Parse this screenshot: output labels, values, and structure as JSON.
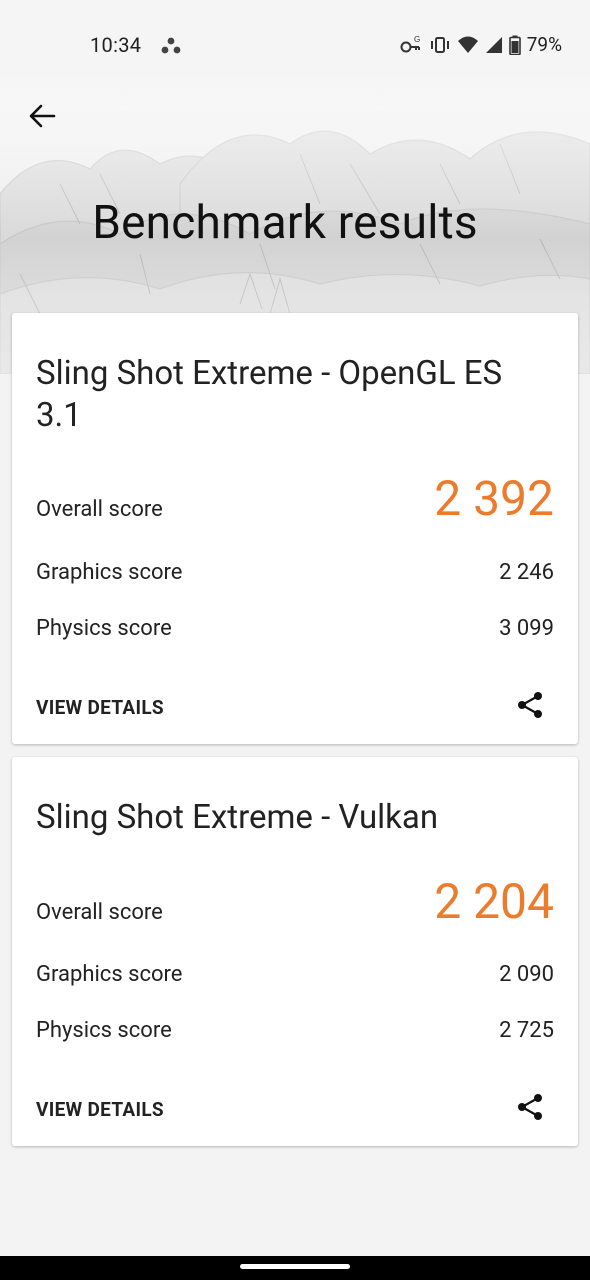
{
  "status_bar": {
    "time": "10:34",
    "battery": "79%",
    "icons": [
      "key-icon",
      "vibrate-icon",
      "wifi-icon",
      "signal-icon",
      "battery-icon"
    ]
  },
  "header": {
    "title": "Benchmark results",
    "back_icon": "arrow-back-icon"
  },
  "results": [
    {
      "title": "Sling Shot Extreme - OpenGL ES 3.1",
      "overall_label": "Overall score",
      "overall_value": "2 392",
      "graphics_label": "Graphics score",
      "graphics_value": "2 246",
      "physics_label": "Physics score",
      "physics_value": "3 099",
      "details_label": "VIEW DETAILS",
      "share_icon": "share-icon"
    },
    {
      "title": "Sling Shot Extreme - Vulkan",
      "overall_label": "Overall score",
      "overall_value": "2 204",
      "graphics_label": "Graphics score",
      "graphics_value": "2 090",
      "physics_label": "Physics score",
      "physics_value": "2 725",
      "details_label": "VIEW DETAILS",
      "share_icon": "share-icon"
    }
  ],
  "colors": {
    "accent": "#ec7b2c",
    "background": "#f3f3f3",
    "card": "#ffffff"
  }
}
